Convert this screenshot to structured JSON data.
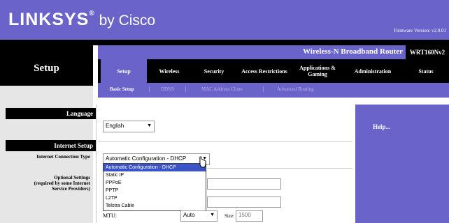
{
  "brand": {
    "logo_main": "LINKSYS",
    "logo_reg": "®",
    "logo_by": " by Cisco"
  },
  "firmware": "Firmware Version: v2.0.01",
  "product": {
    "title": "Wireless-N Broadband Router",
    "model": "WRT160Nv2"
  },
  "section_title": "Setup",
  "tabs": [
    {
      "label": "Setup",
      "active": true
    },
    {
      "label": "Wireless"
    },
    {
      "label": "Security"
    },
    {
      "label": "Access Restrictions"
    },
    {
      "label": "Applications & Gaming"
    },
    {
      "label": "Administration"
    },
    {
      "label": "Status"
    }
  ],
  "subtabs": [
    {
      "label": "Basic Setup",
      "active": true
    },
    {
      "label": "DDNS"
    },
    {
      "label": "MAC Address Clone"
    },
    {
      "label": "Advanced Routing"
    }
  ],
  "subtab_separator": "|",
  "left": {
    "language_header": "Language",
    "internet_setup_header": "Internet Setup",
    "connection_type_label": "Internet Connection Type",
    "optional_label": "Optional Settings",
    "optional_sub": "(required by some Internet",
    "optional_sub2": "Service Providers)"
  },
  "language_select": {
    "value": "English"
  },
  "connection_select": {
    "value": "Automatic Configuration - DHCP",
    "options": [
      "Automatic Configuration - DHCP",
      "Static IP",
      "PPPoE",
      "PPTP",
      "L2TP",
      "Telstra Cable"
    ]
  },
  "help_title": "Help...",
  "mtu": {
    "label": "MTU:",
    "mode": "Auto",
    "size_label": "Size:",
    "size_value": "1500"
  },
  "icons": {
    "dropdown": "▼"
  },
  "colors": {
    "brand_purple": "#6a63c9",
    "selected_option": "#3a53c5"
  }
}
